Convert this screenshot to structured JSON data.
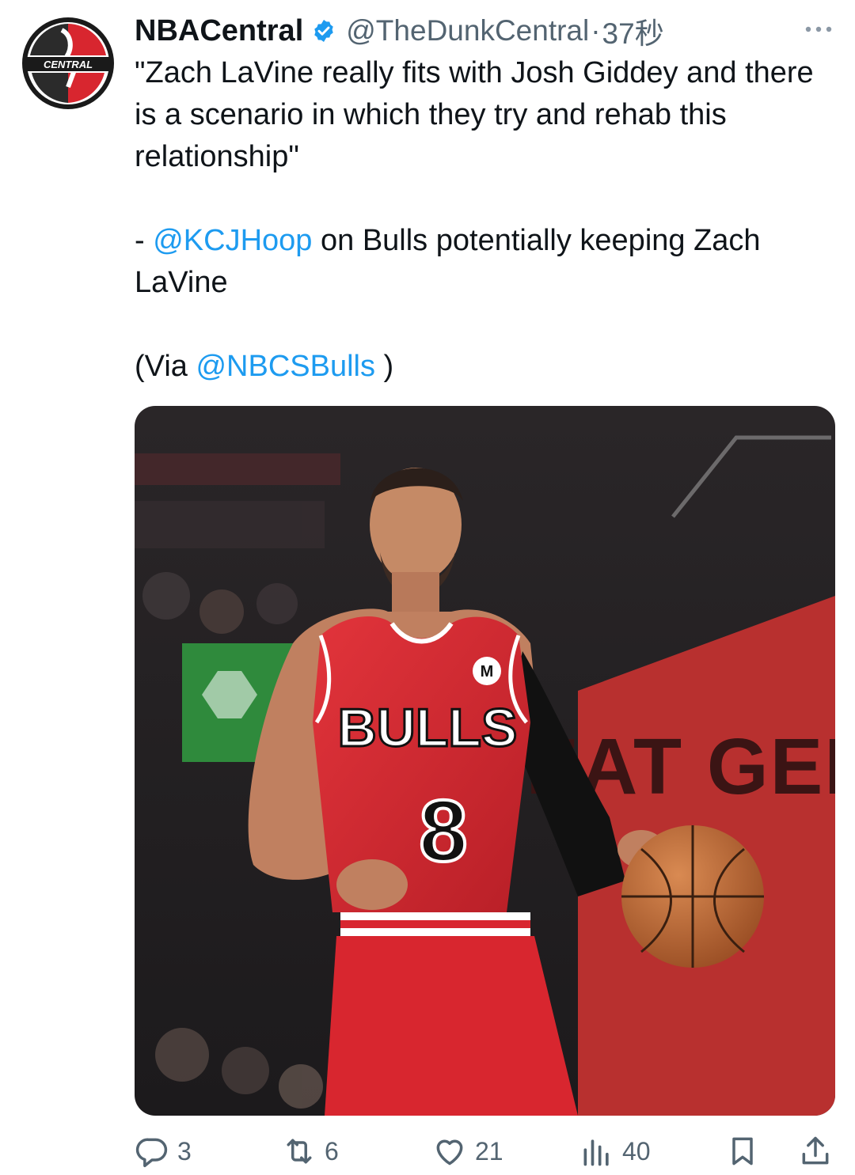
{
  "author": {
    "display_name": "NBACentral",
    "handle": "@TheDunkCentral",
    "separator": "·",
    "time": "37秒",
    "verified": true,
    "avatar_text": "CENTRAL"
  },
  "tweet": {
    "quote": "\"Zach LaVine really fits with Josh Giddey and there is a scenario in which they try and rehab this relationship\"",
    "attribution_prefix": "- ",
    "attribution_mention": "@KCJHoop",
    "attribution_suffix": " on Bulls potentially keeping Zach LaVine",
    "via_prefix": "(Via ",
    "via_mention": "@NBCSBulls",
    "via_suffix": " )"
  },
  "media": {
    "jersey_team": "BULLS",
    "jersey_number": "8",
    "arena_sign": "SEAT GEEK",
    "sponsor_patch": "M"
  },
  "actions": {
    "replies": "3",
    "retweets": "6",
    "likes": "21",
    "views": "40"
  },
  "colors": {
    "accent": "#1d9bf0",
    "text": "#0f1419",
    "muted": "#536471",
    "jersey_red": "#d8262f"
  },
  "icons": [
    "more-icon",
    "verified-badge-icon",
    "reply-icon",
    "retweet-icon",
    "like-icon",
    "views-icon",
    "bookmark-icon",
    "share-icon"
  ]
}
